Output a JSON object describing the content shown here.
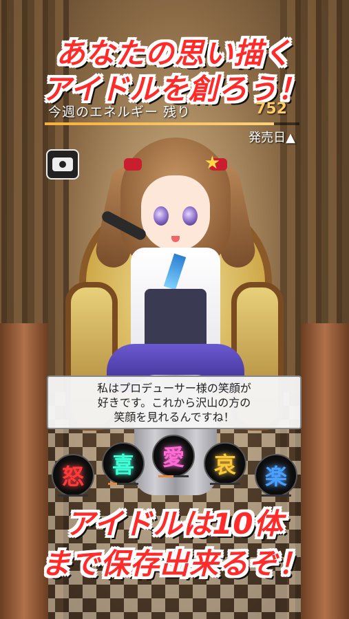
{
  "promo": {
    "line1": "あなたの思い描く",
    "line2": "アイドルを創ろう！",
    "line3": "アイドルは10体",
    "line4": "まで保存出来るぞ！"
  },
  "energy": {
    "label": "今週のエネルギー 残り",
    "value": "752",
    "fill_fraction": 0.9
  },
  "sort_label": "発売日▲",
  "dialog": {
    "lines": [
      "私はプロデューサー様の笑顔が",
      "好きです。これから沢山の方の",
      "笑顔を見れるんですね！"
    ]
  },
  "emotions": [
    {
      "char": "怒",
      "color": "#ff3a3a",
      "level": 0.0
    },
    {
      "char": "喜",
      "color": "#3fffd6",
      "level": 0.3
    },
    {
      "char": "愛",
      "color": "#ff6ad5",
      "level": 0.5
    },
    {
      "char": "哀",
      "color": "#ffc83a",
      "level": 0.0
    },
    {
      "char": "楽",
      "color": "#4aa0ff",
      "level": 0.0
    }
  ],
  "icons": {
    "camera": "camera-icon"
  },
  "colors": {
    "headline": "#ff2a2a",
    "energy_value": "#ffcc66"
  }
}
